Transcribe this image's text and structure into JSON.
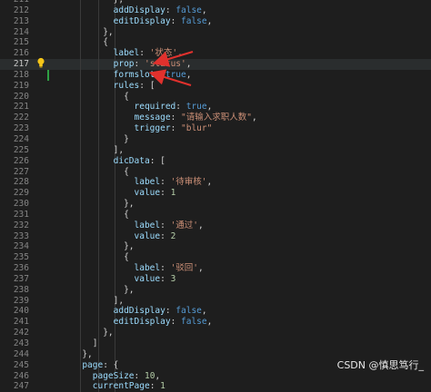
{
  "editor": {
    "lines": [
      {
        "no": "211",
        "tokens": [
          {
            "t": "            },",
            "c": "pun"
          }
        ]
      },
      {
        "no": "212",
        "tokens": [
          {
            "t": "            ",
            "c": "pun"
          },
          {
            "t": "addDisplay",
            "c": "key"
          },
          {
            "t": ": ",
            "c": "pun"
          },
          {
            "t": "false",
            "c": "kw"
          },
          {
            "t": ",",
            "c": "pun"
          }
        ]
      },
      {
        "no": "213",
        "tokens": [
          {
            "t": "            ",
            "c": "pun"
          },
          {
            "t": "editDisplay",
            "c": "key"
          },
          {
            "t": ": ",
            "c": "pun"
          },
          {
            "t": "false",
            "c": "kw"
          },
          {
            "t": ",",
            "c": "pun"
          }
        ]
      },
      {
        "no": "214",
        "tokens": [
          {
            "t": "          },",
            "c": "pun"
          }
        ]
      },
      {
        "no": "215",
        "tokens": [
          {
            "t": "          {",
            "c": "pun"
          }
        ]
      },
      {
        "no": "216",
        "tokens": [
          {
            "t": "            ",
            "c": "pun"
          },
          {
            "t": "label",
            "c": "key"
          },
          {
            "t": ": ",
            "c": "pun"
          },
          {
            "t": "'状态'",
            "c": "str"
          },
          {
            "t": ",",
            "c": "pun"
          }
        ]
      },
      {
        "no": "217",
        "tokens": [
          {
            "t": "            ",
            "c": "pun"
          },
          {
            "t": "prop",
            "c": "key"
          },
          {
            "t": ": ",
            "c": "pun"
          },
          {
            "t": "'status'",
            "c": "str"
          },
          {
            "t": ",",
            "c": "pun"
          }
        ],
        "active": true
      },
      {
        "no": "218",
        "tokens": [
          {
            "t": "            ",
            "c": "pun"
          },
          {
            "t": "formslot",
            "c": "key"
          },
          {
            "t": ": ",
            "c": "pun"
          },
          {
            "t": "true",
            "c": "kw"
          },
          {
            "t": ",",
            "c": "pun"
          }
        ]
      },
      {
        "no": "219",
        "tokens": [
          {
            "t": "            ",
            "c": "pun"
          },
          {
            "t": "rules",
            "c": "key"
          },
          {
            "t": ": [",
            "c": "pun"
          }
        ]
      },
      {
        "no": "220",
        "tokens": [
          {
            "t": "              {",
            "c": "pun"
          }
        ]
      },
      {
        "no": "221",
        "tokens": [
          {
            "t": "                ",
            "c": "pun"
          },
          {
            "t": "required",
            "c": "key"
          },
          {
            "t": ": ",
            "c": "pun"
          },
          {
            "t": "true",
            "c": "kw"
          },
          {
            "t": ",",
            "c": "pun"
          }
        ]
      },
      {
        "no": "222",
        "tokens": [
          {
            "t": "                ",
            "c": "pun"
          },
          {
            "t": "message",
            "c": "key"
          },
          {
            "t": ": ",
            "c": "pun"
          },
          {
            "t": "\"请输入求职人数\"",
            "c": "str"
          },
          {
            "t": ",",
            "c": "pun"
          }
        ]
      },
      {
        "no": "223",
        "tokens": [
          {
            "t": "                ",
            "c": "pun"
          },
          {
            "t": "trigger",
            "c": "key"
          },
          {
            "t": ": ",
            "c": "pun"
          },
          {
            "t": "\"blur\"",
            "c": "str"
          }
        ]
      },
      {
        "no": "224",
        "tokens": [
          {
            "t": "              }",
            "c": "pun"
          }
        ]
      },
      {
        "no": "225",
        "tokens": [
          {
            "t": "            ],",
            "c": "pun"
          }
        ]
      },
      {
        "no": "226",
        "tokens": [
          {
            "t": "            ",
            "c": "pun"
          },
          {
            "t": "dicData",
            "c": "key"
          },
          {
            "t": ": [",
            "c": "pun"
          }
        ]
      },
      {
        "no": "227",
        "tokens": [
          {
            "t": "              {",
            "c": "pun"
          }
        ]
      },
      {
        "no": "228",
        "tokens": [
          {
            "t": "                ",
            "c": "pun"
          },
          {
            "t": "label",
            "c": "key"
          },
          {
            "t": ": ",
            "c": "pun"
          },
          {
            "t": "'待审核'",
            "c": "str"
          },
          {
            "t": ",",
            "c": "pun"
          }
        ]
      },
      {
        "no": "229",
        "tokens": [
          {
            "t": "                ",
            "c": "pun"
          },
          {
            "t": "value",
            "c": "key"
          },
          {
            "t": ": ",
            "c": "pun"
          },
          {
            "t": "1",
            "c": "num"
          }
        ]
      },
      {
        "no": "230",
        "tokens": [
          {
            "t": "              },",
            "c": "pun"
          }
        ]
      },
      {
        "no": "231",
        "tokens": [
          {
            "t": "              {",
            "c": "pun"
          }
        ]
      },
      {
        "no": "232",
        "tokens": [
          {
            "t": "                ",
            "c": "pun"
          },
          {
            "t": "label",
            "c": "key"
          },
          {
            "t": ": ",
            "c": "pun"
          },
          {
            "t": "'通过'",
            "c": "str"
          },
          {
            "t": ",",
            "c": "pun"
          }
        ]
      },
      {
        "no": "233",
        "tokens": [
          {
            "t": "                ",
            "c": "pun"
          },
          {
            "t": "value",
            "c": "key"
          },
          {
            "t": ": ",
            "c": "pun"
          },
          {
            "t": "2",
            "c": "num"
          }
        ]
      },
      {
        "no": "234",
        "tokens": [
          {
            "t": "              },",
            "c": "pun"
          }
        ]
      },
      {
        "no": "235",
        "tokens": [
          {
            "t": "              {",
            "c": "pun"
          }
        ]
      },
      {
        "no": "236",
        "tokens": [
          {
            "t": "                ",
            "c": "pun"
          },
          {
            "t": "label",
            "c": "key"
          },
          {
            "t": ": ",
            "c": "pun"
          },
          {
            "t": "'驳回'",
            "c": "str"
          },
          {
            "t": ",",
            "c": "pun"
          }
        ]
      },
      {
        "no": "237",
        "tokens": [
          {
            "t": "                ",
            "c": "pun"
          },
          {
            "t": "value",
            "c": "key"
          },
          {
            "t": ": ",
            "c": "pun"
          },
          {
            "t": "3",
            "c": "num"
          }
        ]
      },
      {
        "no": "238",
        "tokens": [
          {
            "t": "              },",
            "c": "pun"
          }
        ]
      },
      {
        "no": "239",
        "tokens": [
          {
            "t": "            ],",
            "c": "pun"
          }
        ]
      },
      {
        "no": "240",
        "tokens": [
          {
            "t": "            ",
            "c": "pun"
          },
          {
            "t": "addDisplay",
            "c": "key"
          },
          {
            "t": ": ",
            "c": "pun"
          },
          {
            "t": "false",
            "c": "kw"
          },
          {
            "t": ",",
            "c": "pun"
          }
        ]
      },
      {
        "no": "241",
        "tokens": [
          {
            "t": "            ",
            "c": "pun"
          },
          {
            "t": "editDisplay",
            "c": "key"
          },
          {
            "t": ": ",
            "c": "pun"
          },
          {
            "t": "false",
            "c": "kw"
          },
          {
            "t": ",",
            "c": "pun"
          }
        ]
      },
      {
        "no": "242",
        "tokens": [
          {
            "t": "          },",
            "c": "pun"
          }
        ]
      },
      {
        "no": "243",
        "tokens": [
          {
            "t": "        ]",
            "c": "pun"
          }
        ]
      },
      {
        "no": "244",
        "tokens": [
          {
            "t": "      },",
            "c": "pun"
          }
        ]
      },
      {
        "no": "245",
        "tokens": [
          {
            "t": "      ",
            "c": "pun"
          },
          {
            "t": "page",
            "c": "key"
          },
          {
            "t": ": {",
            "c": "pun"
          }
        ]
      },
      {
        "no": "246",
        "tokens": [
          {
            "t": "        ",
            "c": "pun"
          },
          {
            "t": "pageSize",
            "c": "key"
          },
          {
            "t": ": ",
            "c": "pun"
          },
          {
            "t": "10",
            "c": "num"
          },
          {
            "t": ",",
            "c": "pun"
          }
        ]
      },
      {
        "no": "247",
        "tokens": [
          {
            "t": "        ",
            "c": "pun"
          },
          {
            "t": "currentPage",
            "c": "key"
          },
          {
            "t": ": ",
            "c": "pun"
          },
          {
            "t": "1",
            "c": "num"
          }
        ]
      }
    ]
  },
  "gutter": {
    "lightbulb_icon": "lightbulb-icon"
  },
  "colors": {
    "background": "#1e1e1e",
    "arrow": "#e0312d",
    "line_number": "#858585"
  },
  "watermark": {
    "text": "CSDN @慎思笃行_"
  }
}
